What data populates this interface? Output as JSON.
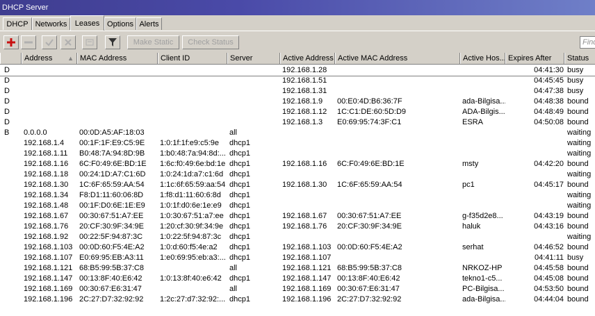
{
  "window": {
    "title": "DHCP Server"
  },
  "tabs": [
    {
      "label": "DHCP",
      "active": false
    },
    {
      "label": "Networks",
      "active": false
    },
    {
      "label": "Leases",
      "active": true
    },
    {
      "label": "Options",
      "active": false
    },
    {
      "label": "Alerts",
      "active": false
    }
  ],
  "toolbar": {
    "add_icon": "plus-icon",
    "remove_icon": "minus-icon",
    "enable_icon": "check-icon",
    "disable_icon": "x-icon",
    "comment_icon": "comment-icon",
    "filter_icon": "filter-icon",
    "make_static_label": "Make Static",
    "check_status_label": "Check Status",
    "find_placeholder": "Find"
  },
  "columns": [
    "",
    "Address",
    "MAC Address",
    "Client ID",
    "Server",
    "Active Address",
    "Active MAC Address",
    "Active Hos...",
    "Expires After",
    "Status"
  ],
  "rows": [
    {
      "flag": "D",
      "address": "",
      "mac": "",
      "client_id": "",
      "server": "",
      "active_address": "192.168.1.28",
      "active_mac": "",
      "active_host": "",
      "expires": "04:41:30",
      "status": "busy"
    },
    {
      "flag": "D",
      "address": "",
      "mac": "",
      "client_id": "",
      "server": "",
      "active_address": "192.168.1.51",
      "active_mac": "",
      "active_host": "",
      "expires": "04:45:45",
      "status": "busy"
    },
    {
      "flag": "D",
      "address": "",
      "mac": "",
      "client_id": "",
      "server": "",
      "active_address": "192.168.1.31",
      "active_mac": "",
      "active_host": "",
      "expires": "04:47:38",
      "status": "busy"
    },
    {
      "flag": "D",
      "address": "",
      "mac": "",
      "client_id": "",
      "server": "",
      "active_address": "192.168.1.9",
      "active_mac": "00:E0:4D:B6:36:7F",
      "active_host": "ada-Bilgisa...",
      "expires": "04:48:38",
      "status": "bound"
    },
    {
      "flag": "D",
      "address": "",
      "mac": "",
      "client_id": "",
      "server": "",
      "active_address": "192.168.1.12",
      "active_mac": "1C:C1:DE:60:5D:D9",
      "active_host": "ADA-Bilgis...",
      "expires": "04:48:49",
      "status": "bound"
    },
    {
      "flag": "D",
      "address": "",
      "mac": "",
      "client_id": "",
      "server": "",
      "active_address": "192.168.1.3",
      "active_mac": "E0:69:95:74:3F:C1",
      "active_host": "ESRA",
      "expires": "04:50:08",
      "status": "bound"
    },
    {
      "flag": "B",
      "address": "0.0.0.0",
      "mac": "00:0D:A5:AF:18:03",
      "client_id": "",
      "server": "all",
      "active_address": "",
      "active_mac": "",
      "active_host": "",
      "expires": "",
      "status": "waiting"
    },
    {
      "flag": "",
      "address": "192.168.1.4",
      "mac": "00:1F:1F:E9:C5:9E",
      "client_id": "1:0:1f:1f:e9:c5:9e",
      "server": "dhcp1",
      "active_address": "",
      "active_mac": "",
      "active_host": "",
      "expires": "",
      "status": "waiting"
    },
    {
      "flag": "",
      "address": "192.168.1.11",
      "mac": "B0:48:7A:94:8D:9B",
      "client_id": "1:b0:48:7a:94:8d:...",
      "server": "dhcp1",
      "active_address": "",
      "active_mac": "",
      "active_host": "",
      "expires": "",
      "status": "waiting"
    },
    {
      "flag": "",
      "address": "192.168.1.16",
      "mac": "6C:F0:49:6E:BD:1E",
      "client_id": "1:6c:f0:49:6e:bd:1e",
      "server": "dhcp1",
      "active_address": "192.168.1.16",
      "active_mac": "6C:F0:49:6E:BD:1E",
      "active_host": "msty",
      "expires": "04:42:20",
      "status": "bound"
    },
    {
      "flag": "",
      "address": "192.168.1.18",
      "mac": "00:24:1D:A7:C1:6D",
      "client_id": "1:0:24:1d:a7:c1:6d",
      "server": "dhcp1",
      "active_address": "",
      "active_mac": "",
      "active_host": "",
      "expires": "",
      "status": "waiting"
    },
    {
      "flag": "",
      "address": "192.168.1.30",
      "mac": "1C:6F:65:59:AA:54",
      "client_id": "1:1c:6f:65:59:aa:54",
      "server": "dhcp1",
      "active_address": "192.168.1.30",
      "active_mac": "1C:6F:65:59:AA:54",
      "active_host": "pc1",
      "expires": "04:45:17",
      "status": "bound"
    },
    {
      "flag": "",
      "address": "192.168.1.34",
      "mac": "F8:D1:11:60:06:8D",
      "client_id": "1:f8:d1:11:60:6:8d",
      "server": "dhcp1",
      "active_address": "",
      "active_mac": "",
      "active_host": "",
      "expires": "",
      "status": "waiting"
    },
    {
      "flag": "",
      "address": "192.168.1.48",
      "mac": "00:1F:D0:6E:1E:E9",
      "client_id": "1:0:1f:d0:6e:1e:e9",
      "server": "dhcp1",
      "active_address": "",
      "active_mac": "",
      "active_host": "",
      "expires": "",
      "status": "waiting"
    },
    {
      "flag": "",
      "address": "192.168.1.67",
      "mac": "00:30:67:51:A7:EE",
      "client_id": "1:0:30:67:51:a7:ee",
      "server": "dhcp1",
      "active_address": "192.168.1.67",
      "active_mac": "00:30:67:51:A7:EE",
      "active_host": "g-f35d2e8...",
      "expires": "04:43:19",
      "status": "bound"
    },
    {
      "flag": "",
      "address": "192.168.1.76",
      "mac": "20:CF:30:9F:34:9E",
      "client_id": "1:20:cf:30:9f:34:9e",
      "server": "dhcp1",
      "active_address": "192.168.1.76",
      "active_mac": "20:CF:30:9F:34:9E",
      "active_host": "haluk",
      "expires": "04:43:16",
      "status": "bound"
    },
    {
      "flag": "",
      "address": "192.168.1.92",
      "mac": "00:22:5F:94:87:3C",
      "client_id": "1:0:22:5f:94:87:3c",
      "server": "dhcp1",
      "active_address": "",
      "active_mac": "",
      "active_host": "",
      "expires": "",
      "status": "waiting"
    },
    {
      "flag": "",
      "address": "192.168.1.103",
      "mac": "00:0D:60:F5:4E:A2",
      "client_id": "1:0:d:60:f5:4e:a2",
      "server": "dhcp1",
      "active_address": "192.168.1.103",
      "active_mac": "00:0D:60:F5:4E:A2",
      "active_host": "serhat",
      "expires": "04:46:52",
      "status": "bound"
    },
    {
      "flag": "",
      "address": "192.168.1.107",
      "mac": "E0:69:95:EB:A3:11",
      "client_id": "1:e0:69:95:eb:a3:...",
      "server": "dhcp1",
      "active_address": "192.168.1.107",
      "active_mac": "",
      "active_host": "",
      "expires": "04:41:11",
      "status": "busy"
    },
    {
      "flag": "",
      "address": "192.168.1.121",
      "mac": "68:B5:99:5B:37:C8",
      "client_id": "",
      "server": "all",
      "active_address": "192.168.1.121",
      "active_mac": "68:B5:99:5B:37:C8",
      "active_host": "NRKOZ-HP",
      "expires": "04:45:58",
      "status": "bound"
    },
    {
      "flag": "",
      "address": "192.168.1.147",
      "mac": "00:13:8F:40:E6:42",
      "client_id": "1:0:13:8f:40:e6:42",
      "server": "dhcp1",
      "active_address": "192.168.1.147",
      "active_mac": "00:13:8F:40:E6:42",
      "active_host": "tekno1-c5...",
      "expires": "04:45:08",
      "status": "bound"
    },
    {
      "flag": "",
      "address": "192.168.1.169",
      "mac": "00:30:67:E6:31:47",
      "client_id": "",
      "server": "all",
      "active_address": "192.168.1.169",
      "active_mac": "00:30:67:E6:31:47",
      "active_host": "PC-Bilgisa...",
      "expires": "04:53:50",
      "status": "bound"
    },
    {
      "flag": "",
      "address": "192.168.1.196",
      "mac": "2C:27:D7:32:92:92",
      "client_id": "1:2c:27:d7:32:92:...",
      "server": "dhcp1",
      "active_address": "192.168.1.196",
      "active_mac": "2C:27:D7:32:92:92",
      "active_host": "ada-Bilgisa...",
      "expires": "04:44:04",
      "status": "bound"
    }
  ]
}
